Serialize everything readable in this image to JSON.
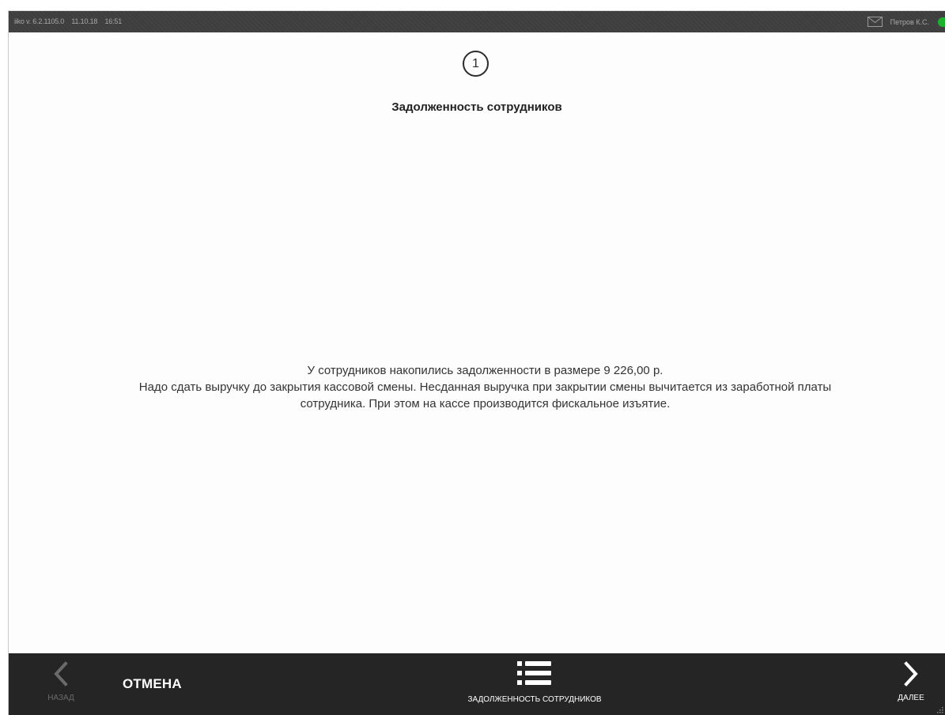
{
  "titlebar": {
    "version": "iiko v. 6.2.1105.0",
    "date": "11.10.18",
    "time": "16:51",
    "user": "Петров К.С.",
    "status_color": "#18b32a"
  },
  "step": {
    "number": "1",
    "title": "Задолженность сотрудников"
  },
  "message": {
    "line1": "У сотрудников накопились задолженности в размере 9 226,00 р.",
    "line2": "Надо сдать выручку до закрытия кассовой смены. Несданная выручка при закрытии смены вычитается из заработной платы",
    "line3": "сотрудника. При этом на кассе производится фискальное изъятие."
  },
  "bottombar": {
    "back_label": "НАЗАД",
    "cancel_label": "ОТМЕНА",
    "debts_label": "ЗАДОЛЖЕННОСТЬ СОТРУДНИКОВ",
    "next_label": "ДАЛЕЕ",
    "icons": {
      "back": "chevron-left-icon",
      "debts": "list-icon",
      "next": "chevron-right-icon",
      "mail": "mail-icon"
    }
  }
}
